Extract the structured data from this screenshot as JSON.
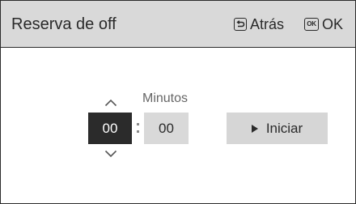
{
  "header": {
    "title": "Reserva de off",
    "back_label": "Atrás",
    "back_icon": "return-key-icon",
    "ok_key_label": "OK",
    "ok_label": "OK"
  },
  "timer": {
    "minutes_label": "Minutos",
    "hours_value": "00",
    "separator": ":",
    "minutes_value": "00",
    "up_icon": "chevron-up-icon",
    "down_icon": "chevron-down-icon"
  },
  "start_button": {
    "label": "Iniciar",
    "icon": "play-icon"
  },
  "colors": {
    "header_bg": "#d9d9d9",
    "selected_field_bg": "#2b2b2b",
    "field_bg": "#d9d9d9",
    "button_bg": "#d6d6d6"
  }
}
